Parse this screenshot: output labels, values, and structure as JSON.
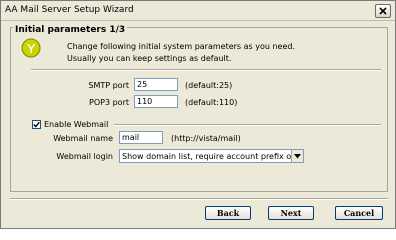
{
  "window": {
    "title": "AA Mail Server Setup Wizard"
  },
  "group": {
    "title": "Initial parameters 1/3",
    "description_line1": "Change following initial system parameters as you need.",
    "description_line2": "Usually you can keep settings as default."
  },
  "fields": {
    "smtp": {
      "label": "SMTP port",
      "value": "25",
      "hint": "(default:25)"
    },
    "pop3": {
      "label": "POP3 port",
      "value": "110",
      "hint": "(default:110)"
    }
  },
  "webmail": {
    "enable_label": "Enable Webmail",
    "enabled": true,
    "name_label": "Webmail name",
    "name_value": "mail",
    "name_hint": "(http://vista/mail)",
    "login_label": "Webmail login",
    "login_selected": "Show domain list, require account prefix only"
  },
  "buttons": {
    "back": "Back",
    "next": "Next",
    "cancel": "Cancel"
  },
  "icons": {
    "logo": "app-logo-icon",
    "close": "close-icon",
    "dropdown": "chevron-down-icon",
    "check": "checkmark-icon"
  }
}
